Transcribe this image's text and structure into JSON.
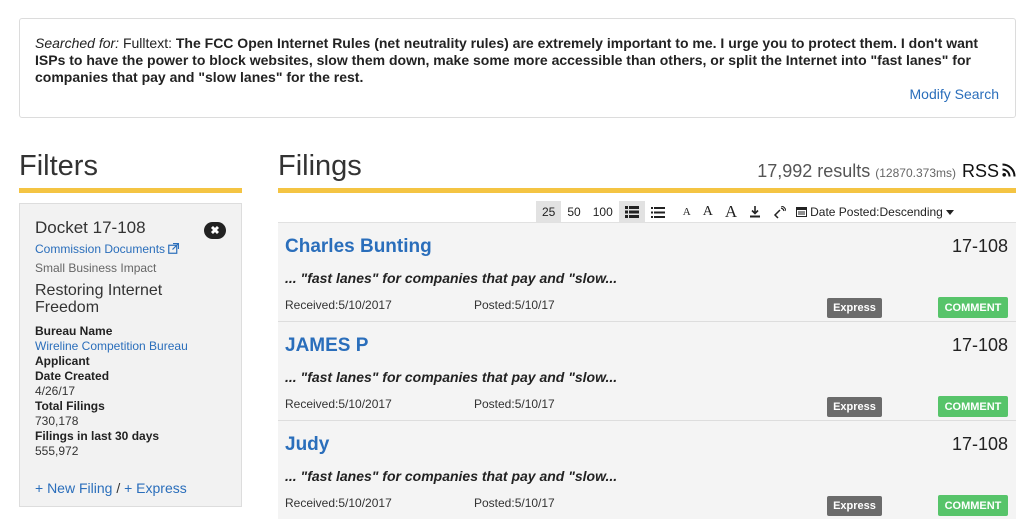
{
  "search": {
    "prefix": "Searched for:",
    "type": "Fulltext:",
    "query": "The FCC Open Internet Rules (net neutrality rules) are extremely important to me. I urge you to protect them. I don't want ISPs to have the power to block websites, slow them down, make some more accessible than others, or split the Internet into \"fast lanes\" for companies that pay and \"slow lanes\" for the rest.",
    "modify_label": "Modify Search"
  },
  "filters": {
    "heading": "Filters",
    "docket_title": "Docket 17-108",
    "remove_icon": "close-icon",
    "commission_docs": "Commission Documents",
    "small_business": "Small Business Impact",
    "proceeding": "Restoring Internet Freedom",
    "bureau_label": "Bureau Name",
    "bureau_value": "Wireline Competition Bureau",
    "applicant_label": "Applicant",
    "date_created_label": "Date Created",
    "date_created_value": "4/26/17",
    "total_filings_label": "Total Filings",
    "total_filings_value": "730,178",
    "last30_label": "Filings in last 30 days",
    "last30_value": "555,972",
    "new_filing": "+ New Filing",
    "separator": "/",
    "express": "+ Express"
  },
  "filings": {
    "heading": "Filings",
    "results_count": "17,992 results",
    "results_time": "(12870.373ms)",
    "rss_label": "RSS",
    "toolbar": {
      "page_sizes": [
        "25",
        "50",
        "100"
      ],
      "active_page_size": "25",
      "font_small": "A",
      "font_medium": "A",
      "font_large": "A",
      "sort_label": "Date Posted:Descending"
    },
    "items": [
      {
        "filer": "Charles Bunting",
        "docket": "17-108",
        "excerpt": "... \"fast lanes\" for companies that pay and \"slow...",
        "received": "Received:5/10/2017",
        "posted": "Posted:5/10/17",
        "type_badge": "Express",
        "status_badge": "COMMENT"
      },
      {
        "filer": "JAMES P",
        "docket": "17-108",
        "excerpt": "... \"fast lanes\" for companies that pay and \"slow...",
        "received": "Received:5/10/2017",
        "posted": "Posted:5/10/17",
        "type_badge": "Express",
        "status_badge": "COMMENT"
      },
      {
        "filer": "Judy",
        "docket": "17-108",
        "excerpt": "... \"fast lanes\" for companies that pay and \"slow...",
        "received": "Received:5/10/2017",
        "posted": "Posted:5/10/17",
        "type_badge": "Express",
        "status_badge": "COMMENT"
      }
    ]
  },
  "colors": {
    "accent_yellow": "#f4c443",
    "link_blue": "#2a6ebb",
    "comment_green": "#57c46a",
    "express_gray": "#6b6b6b"
  }
}
